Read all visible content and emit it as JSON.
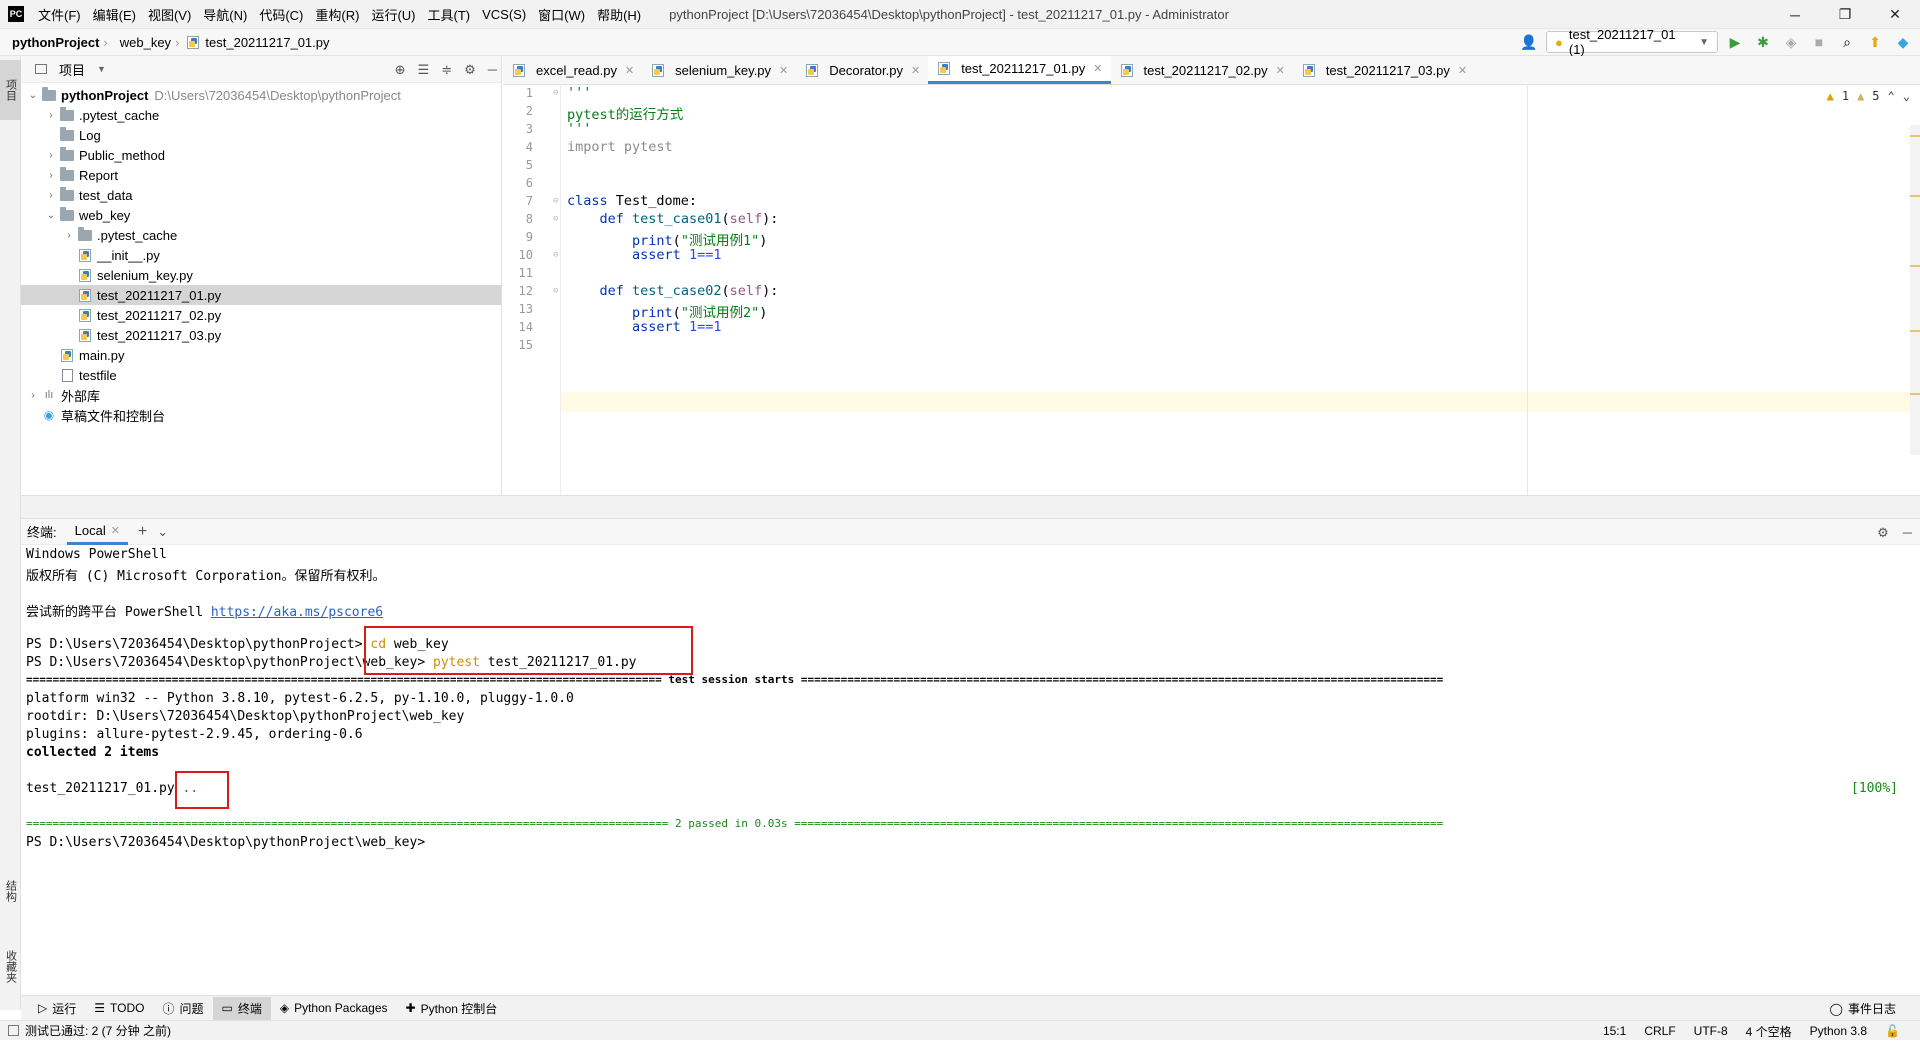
{
  "menubar": {
    "logo": "PC",
    "items": [
      "文件(F)",
      "编辑(E)",
      "视图(V)",
      "导航(N)",
      "代码(C)",
      "重构(R)",
      "运行(U)",
      "工具(T)",
      "VCS(S)",
      "窗口(W)",
      "帮助(H)"
    ],
    "title": "pythonProject [D:\\Users\\72036454\\Desktop\\pythonProject] - test_20211217_01.py - Administrator",
    "controls": [
      "─",
      "❐",
      "✕"
    ]
  },
  "navbar": {
    "crumbs": [
      "pythonProject",
      "web_key",
      "test_20211217_01.py"
    ],
    "run_config": "test_20211217_01 (1)"
  },
  "left_strip": {
    "project_tab": "项目",
    "structure_tab": "结构",
    "favorites_tab": "收藏夹"
  },
  "project_panel": {
    "title": "项目",
    "tree": [
      {
        "label": "pythonProject",
        "path": "D:\\Users\\72036454\\Desktop\\pythonProject",
        "type": "folder",
        "depth": 0,
        "expanded": true,
        "bold": true
      },
      {
        "label": ".pytest_cache",
        "type": "folder",
        "depth": 1,
        "collapsed": true
      },
      {
        "label": "Log",
        "type": "folder",
        "depth": 1
      },
      {
        "label": "Public_method",
        "type": "folder",
        "depth": 1,
        "collapsed": true
      },
      {
        "label": "Report",
        "type": "folder",
        "depth": 1,
        "collapsed": true
      },
      {
        "label": "test_data",
        "type": "folder",
        "depth": 1,
        "collapsed": true
      },
      {
        "label": "web_key",
        "type": "folder",
        "depth": 1,
        "expanded": true
      },
      {
        "label": ".pytest_cache",
        "type": "folder",
        "depth": 2,
        "collapsed": true
      },
      {
        "label": "__init__.py",
        "type": "py",
        "depth": 2
      },
      {
        "label": "selenium_key.py",
        "type": "py",
        "depth": 2
      },
      {
        "label": "test_20211217_01.py",
        "type": "py",
        "depth": 2,
        "selected": true
      },
      {
        "label": "test_20211217_02.py",
        "type": "py",
        "depth": 2
      },
      {
        "label": "test_20211217_03.py",
        "type": "py",
        "depth": 2
      },
      {
        "label": "main.py",
        "type": "py",
        "depth": 1
      },
      {
        "label": "testfile",
        "type": "text",
        "depth": 1
      },
      {
        "label": "外部库",
        "type": "lib",
        "depth": 0,
        "collapsed": true
      },
      {
        "label": "草稿文件和控制台",
        "type": "scratch",
        "depth": 0
      }
    ]
  },
  "editor": {
    "tabs": [
      {
        "label": "excel_read.py",
        "active": false
      },
      {
        "label": "selenium_key.py",
        "active": false
      },
      {
        "label": "Decorator.py",
        "active": false
      },
      {
        "label": "test_20211217_01.py",
        "active": true
      },
      {
        "label": "test_20211217_02.py",
        "active": false
      },
      {
        "label": "test_20211217_03.py",
        "active": false
      }
    ],
    "warnings": {
      "errors": "1",
      "weak": "5"
    },
    "line_numbers": [
      "1",
      "2",
      "3",
      "4",
      "5",
      "6",
      "7",
      "8",
      "9",
      "10",
      "11",
      "12",
      "13",
      "14",
      "15"
    ],
    "lines": {
      "l1": "'''",
      "l2": "pytest的运行方式",
      "l3": "'''",
      "l4": "import pytest",
      "l7_kw": "class",
      "l7_rest": " Test_dome:",
      "l8_kw": "def",
      "l8_fn": "test_case01",
      "l8_self": "self",
      "l9_fn": "print",
      "l9_str": "\"测试用例1\"",
      "l10_kw": "assert",
      "l10_num": "1==1",
      "l12_kw": "def",
      "l12_fn": "test_case02",
      "l12_self": "self",
      "l13_fn": "print",
      "l13_str": "\"测试用例2\"",
      "l14_kw": "assert",
      "l14_num": "1==1"
    }
  },
  "terminal": {
    "label": "终端:",
    "tab": "Local",
    "lines": {
      "t1": "Windows PowerShell",
      "t2": "版权所有 (C) Microsoft Corporation。保留所有权利。",
      "t4a": "尝试新的跨平台 PowerShell ",
      "t4link": "https://aka.ms/pscore6",
      "t6prompt": "PS D:\\Users\\72036454\\Desktop\\pythonProject> ",
      "t6cmd": "cd",
      "t6arg": " web_key",
      "t7prompt": "PS D:\\Users\\72036454\\Desktop\\pythonProject\\web_key> ",
      "t7cmd": "pytest",
      "t7arg": " test_20211217_01.py",
      "t8": "================================================================================================ test session starts =================================================================================================",
      "t9": "platform win32 -- Python 3.8.10, pytest-6.2.5, py-1.10.0, pluggy-1.0.0",
      "t10": "rootdir: D:\\Users\\72036454\\Desktop\\pythonProject\\web_key",
      "t11": "plugins: allure-pytest-2.9.45, ordering-0.6",
      "t12": "collected 2 items",
      "t14a": "test_20211217_01.py",
      "t14b": " ..",
      "t14pct": "[100%]",
      "t16": "================================================================================================= 2 passed in 0.03s ==================================================================================================",
      "t17": "PS D:\\Users\\72036454\\Desktop\\pythonProject\\web_key>"
    }
  },
  "bottom_tools": {
    "items": [
      "运行",
      "TODO",
      "问题",
      "终端",
      "Python Packages",
      "Python 控制台"
    ],
    "event_log": "事件日志"
  },
  "statusbar": {
    "message": "测试已通过: 2 (7 分钟 之前)",
    "position": "15:1",
    "line_sep": "CRLF",
    "encoding": "UTF-8",
    "indent": "4 个空格",
    "interpreter": "Python 3.8"
  }
}
